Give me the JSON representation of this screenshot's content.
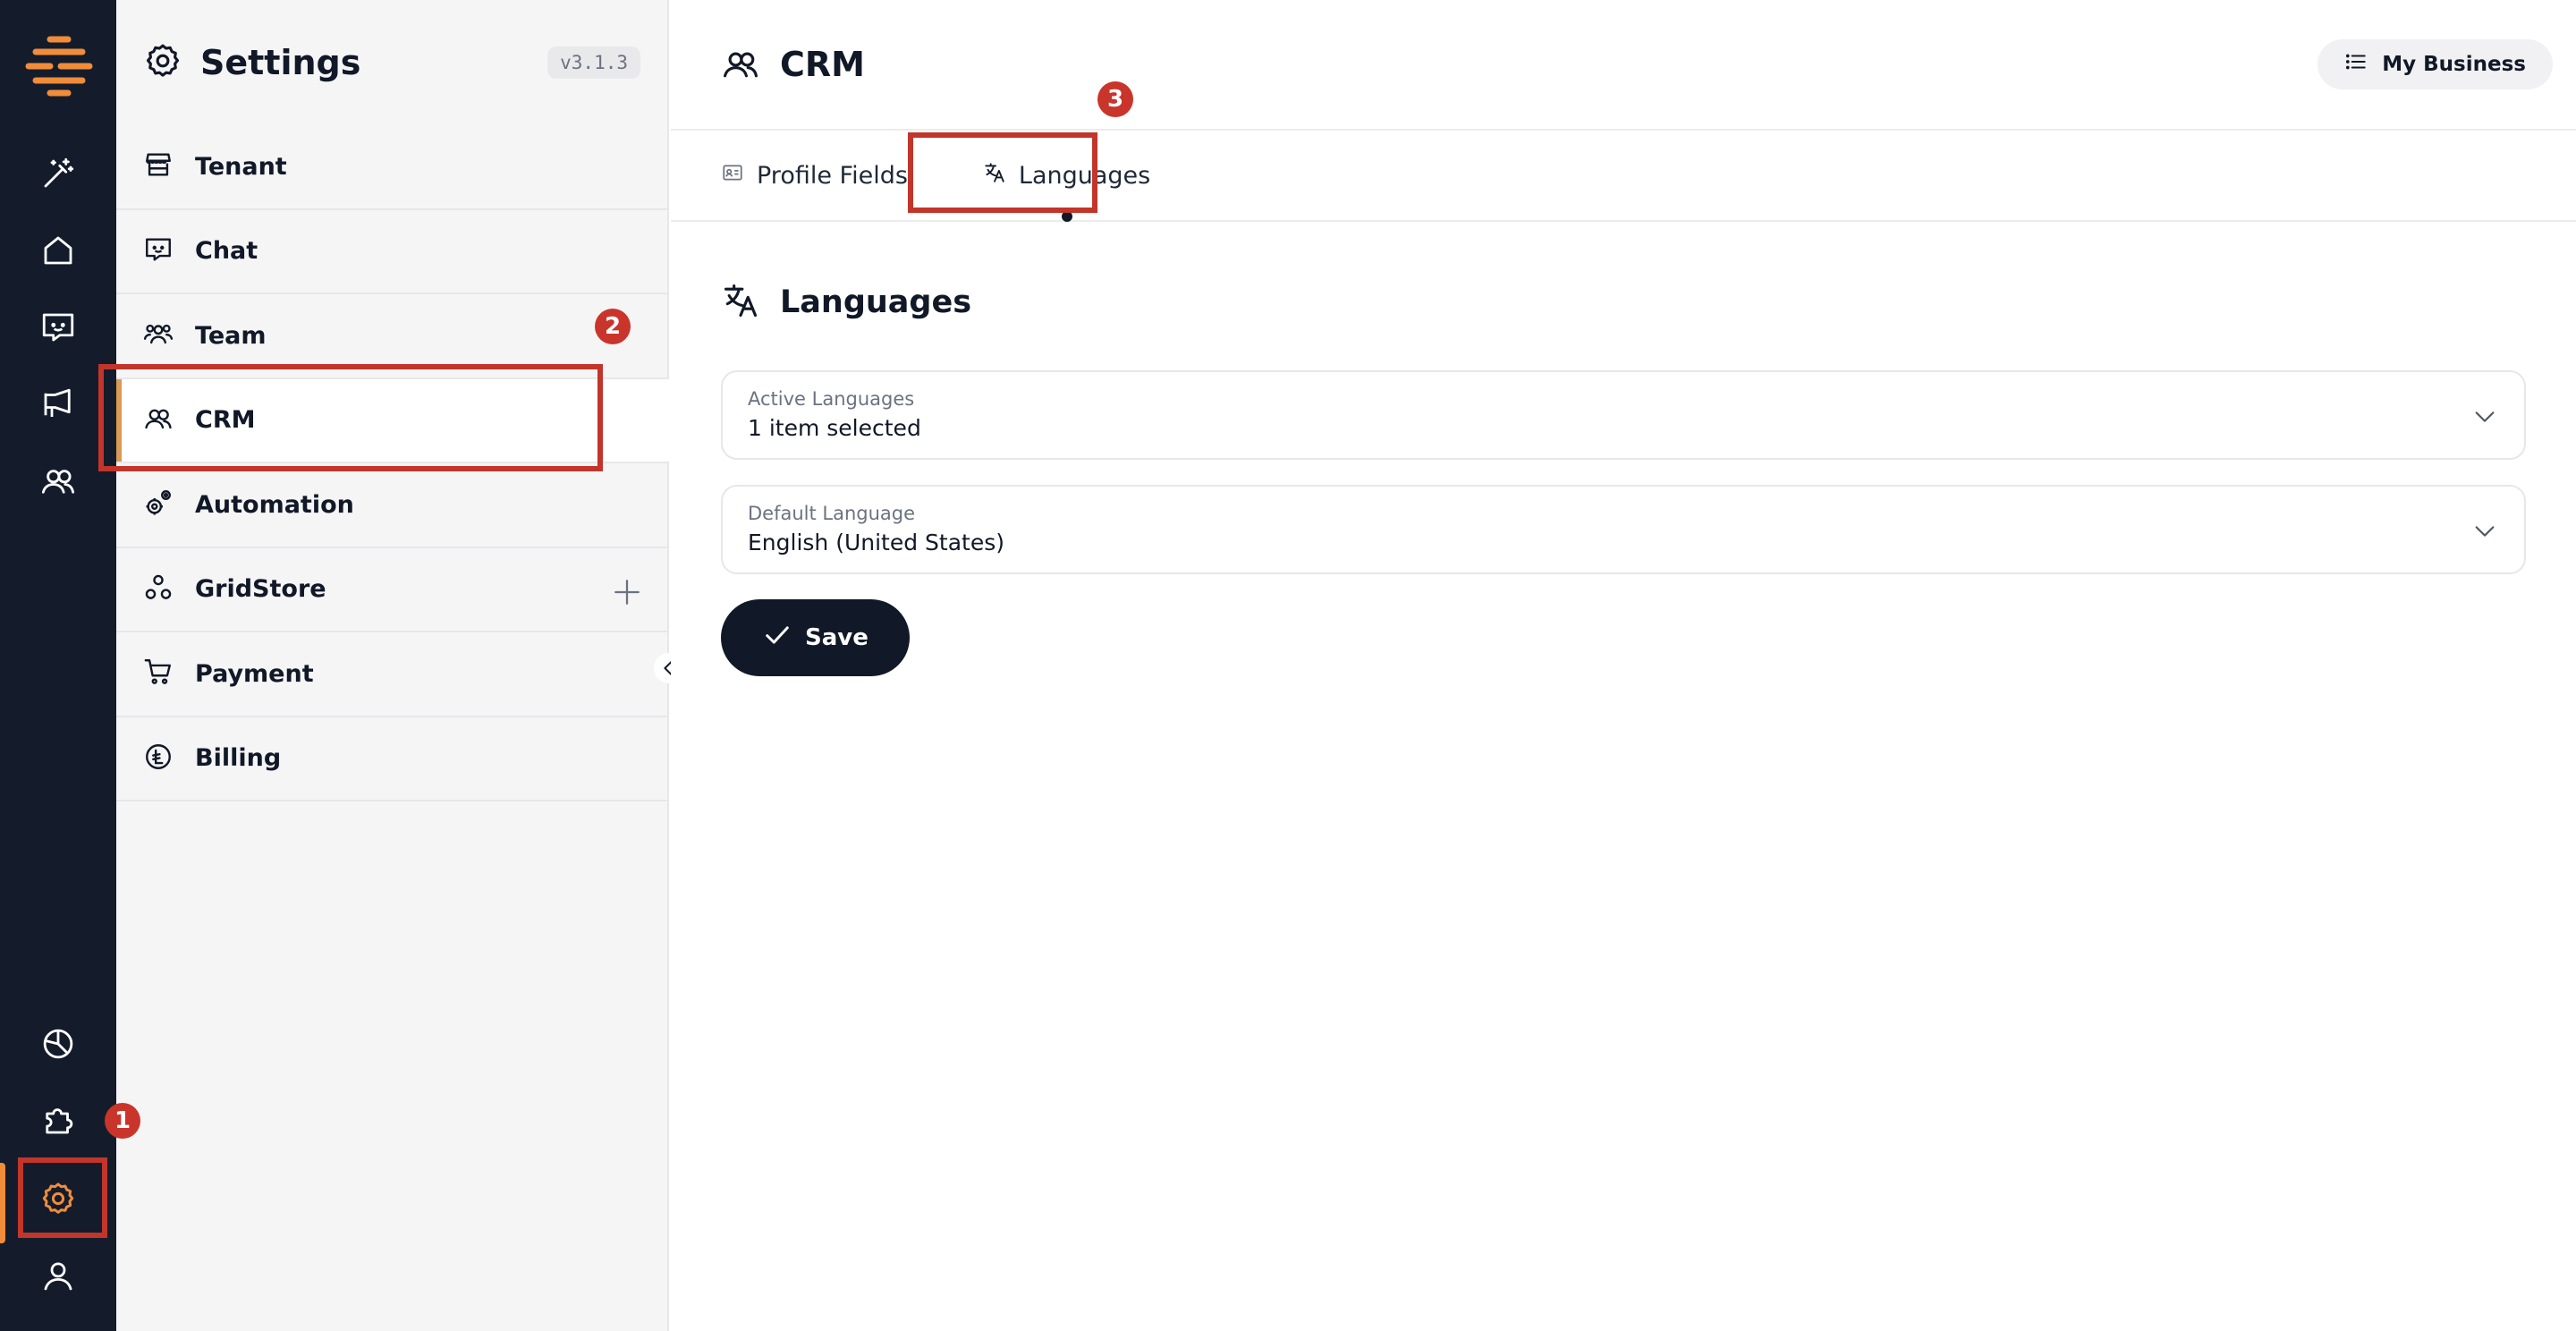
{
  "rail": {
    "logo_icon": "brand-logo",
    "top_items": [
      {
        "icon": "magic-wand-icon",
        "name": "rail-item-ai"
      },
      {
        "icon": "home-icon",
        "name": "rail-item-home"
      },
      {
        "icon": "chat-icon",
        "name": "rail-item-chat"
      },
      {
        "icon": "megaphone-icon",
        "name": "rail-item-campaigns"
      },
      {
        "icon": "users-icon",
        "name": "rail-item-crm"
      }
    ],
    "bottom_items": [
      {
        "icon": "pie-chart-icon",
        "name": "rail-item-analytics"
      },
      {
        "icon": "puzzle-icon",
        "name": "rail-item-integrations"
      },
      {
        "icon": "gear-icon",
        "name": "rail-item-settings",
        "active": true
      },
      {
        "icon": "user-icon",
        "name": "rail-item-profile"
      }
    ],
    "accent_color": "#f08c3a"
  },
  "sidebar": {
    "title": "Settings",
    "version": "v3.1.3",
    "items": [
      {
        "label": "Tenant",
        "icon": "store-icon"
      },
      {
        "label": "Chat",
        "icon": "chat-icon"
      },
      {
        "label": "Team",
        "icon": "team-icon"
      },
      {
        "label": "CRM",
        "icon": "users-icon",
        "active": true
      },
      {
        "label": "Automation",
        "icon": "cogs-icon"
      },
      {
        "label": "GridStore",
        "icon": "nodes-icon",
        "has_add": true
      },
      {
        "label": "Payment",
        "icon": "cart-icon"
      },
      {
        "label": "Billing",
        "icon": "coin-icon"
      }
    ]
  },
  "header": {
    "title": "CRM",
    "business_button": "My Business"
  },
  "tabs": [
    {
      "label": "Profile Fields",
      "icon": "id-card-icon"
    },
    {
      "label": "Languages",
      "icon": "translate-icon",
      "active": true
    }
  ],
  "section": {
    "title": "Languages",
    "fields": [
      {
        "label": "Active Languages",
        "value": "1 item selected"
      },
      {
        "label": "Default Language",
        "value": "English (United States)"
      }
    ],
    "save_label": "Save"
  },
  "annotations": {
    "badges": [
      "1",
      "2",
      "3"
    ],
    "color": "#c2352b"
  }
}
